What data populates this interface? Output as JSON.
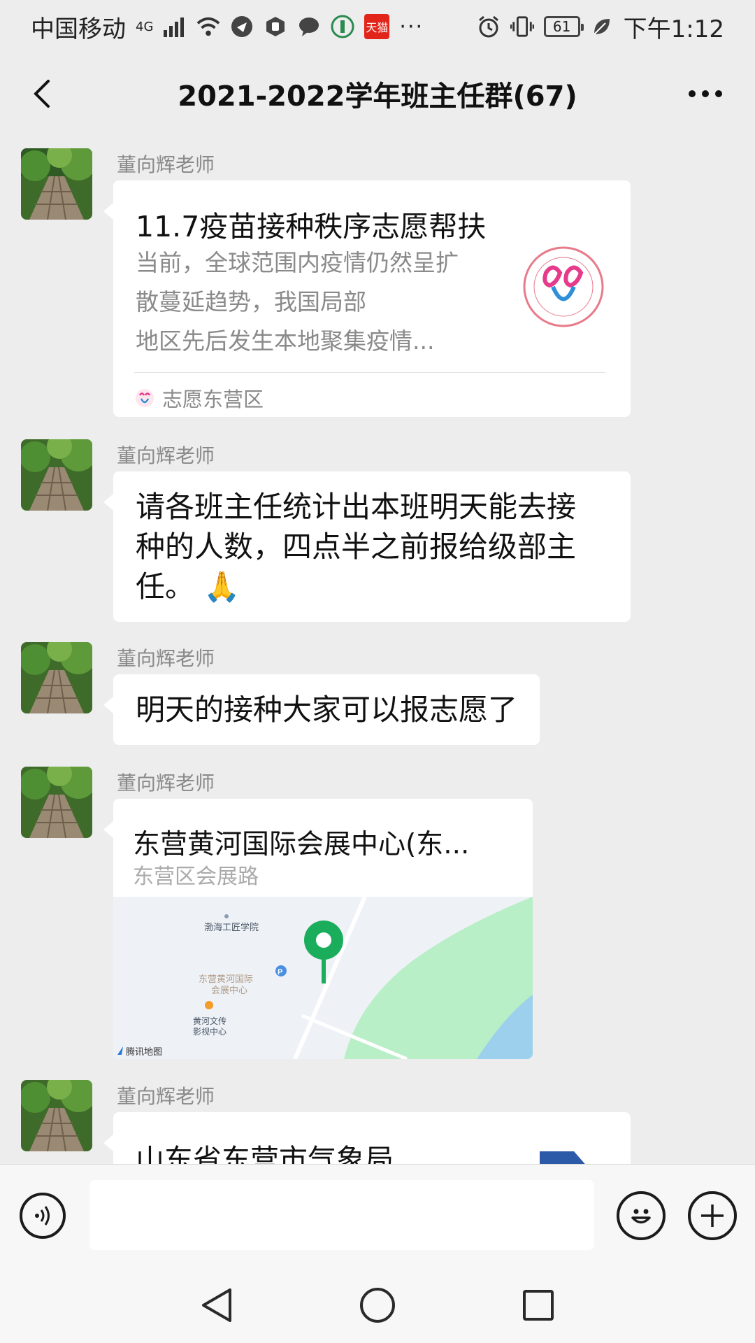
{
  "status_bar": {
    "carrier": "中国移动",
    "network": "4G",
    "tmall_label": "天猫",
    "more": "···",
    "battery": "61",
    "time": "下午1:12",
    "icons": [
      "signal-icon",
      "wifi-icon",
      "app-icon",
      "shield-icon",
      "chat-bubble-icon",
      "app-icon",
      "alarm-icon",
      "vibrate-icon",
      "leaf-icon"
    ]
  },
  "header": {
    "title": "2021-2022学年班主任群(67)",
    "back_icon": "chevron-left-icon",
    "more_icon": "more-dots-icon"
  },
  "messages": [
    {
      "type": "link_card",
      "sender": "董向辉老师",
      "title": "11.7疫苗接种秩序志愿帮扶",
      "description_lines": [
        "当前，全球范围内疫情仍然呈扩",
        "散蔓延趋势，我国局部",
        "地区先后发生本地聚集疫情..."
      ],
      "source": "志愿东营区"
    },
    {
      "type": "text",
      "sender": "董向辉老师",
      "lines": [
        "请各班主任统计出本班明天能去接",
        "种的人数，四点半之前报给级部主",
        "任。"
      ],
      "emoji": "🙏"
    },
    {
      "type": "text",
      "sender": "董向辉老师",
      "lines": [
        "明天的接种大家可以报志愿了"
      ]
    },
    {
      "type": "location",
      "sender": "董向辉老师",
      "title": "东营黄河国际会展中心(东...",
      "address": "东营区会展路",
      "map_labels": {
        "place1": "渤海工匠学院",
        "place2_line1": "东营黄河国际",
        "place2_line2": "会展中心",
        "place3_line1": "黄河文传",
        "place3_line2": "影视中心",
        "provider": "腾讯地图",
        "parking": "P"
      }
    },
    {
      "type": "link_card",
      "sender": "董向辉老师",
      "title": "山东省东营市气象局"
    }
  ],
  "input_bar": {
    "voice_icon": "voice-icon",
    "emoji_icon": "emoji-icon",
    "plus_icon": "plus-icon",
    "value": ""
  },
  "nav_bar": {
    "icons": [
      "nav-back-icon",
      "nav-home-icon",
      "nav-recents-icon"
    ]
  },
  "colors": {
    "background": "#ededed",
    "bubble": "#ffffff",
    "map_pin": "#1aad5b",
    "tmall": "#e1251b"
  }
}
